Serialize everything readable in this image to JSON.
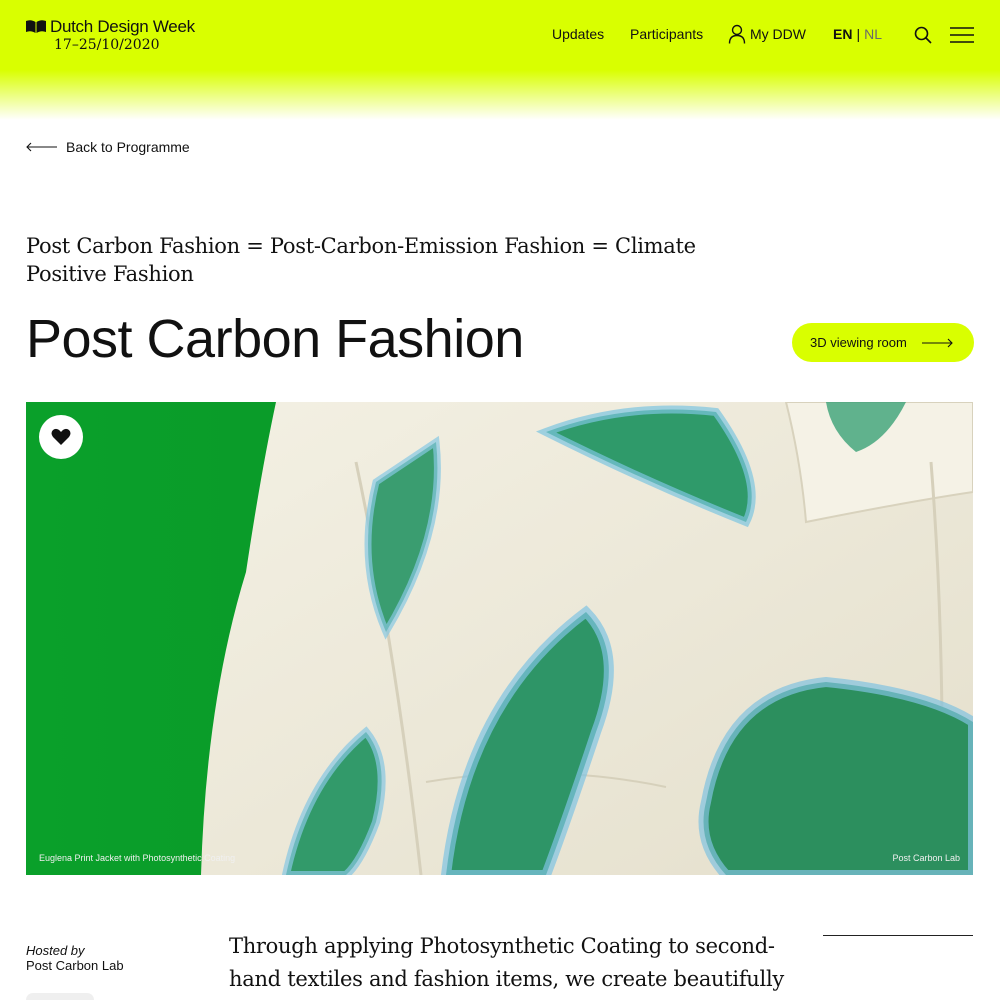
{
  "header": {
    "logo_name": "Dutch Design Week",
    "logo_dates": "17–25/10/2020",
    "nav": {
      "updates": "Updates",
      "participants": "Participants",
      "my_ddw": "My DDW"
    },
    "lang": {
      "active": "EN",
      "separator": "|",
      "inactive": "NL"
    },
    "accent_color": "#d9ff00"
  },
  "back_link": "Back to Programme",
  "page": {
    "subtitle": "Post Carbon Fashion = Post-Carbon-Emission Fashion = Climate Positive Fashion",
    "title": "Post Carbon Fashion",
    "viewing_button": "3D viewing room"
  },
  "hero": {
    "caption_left": "Euglena Print Jacket with Photosynthetic Coating",
    "caption_right": "Post Carbon Lab"
  },
  "details": {
    "hosted_label": "Hosted by",
    "host": "Post Carbon Lab",
    "body": "Through applying Photosynthetic Coating to second-hand textiles and fashion items, we create beautifully coloured"
  }
}
